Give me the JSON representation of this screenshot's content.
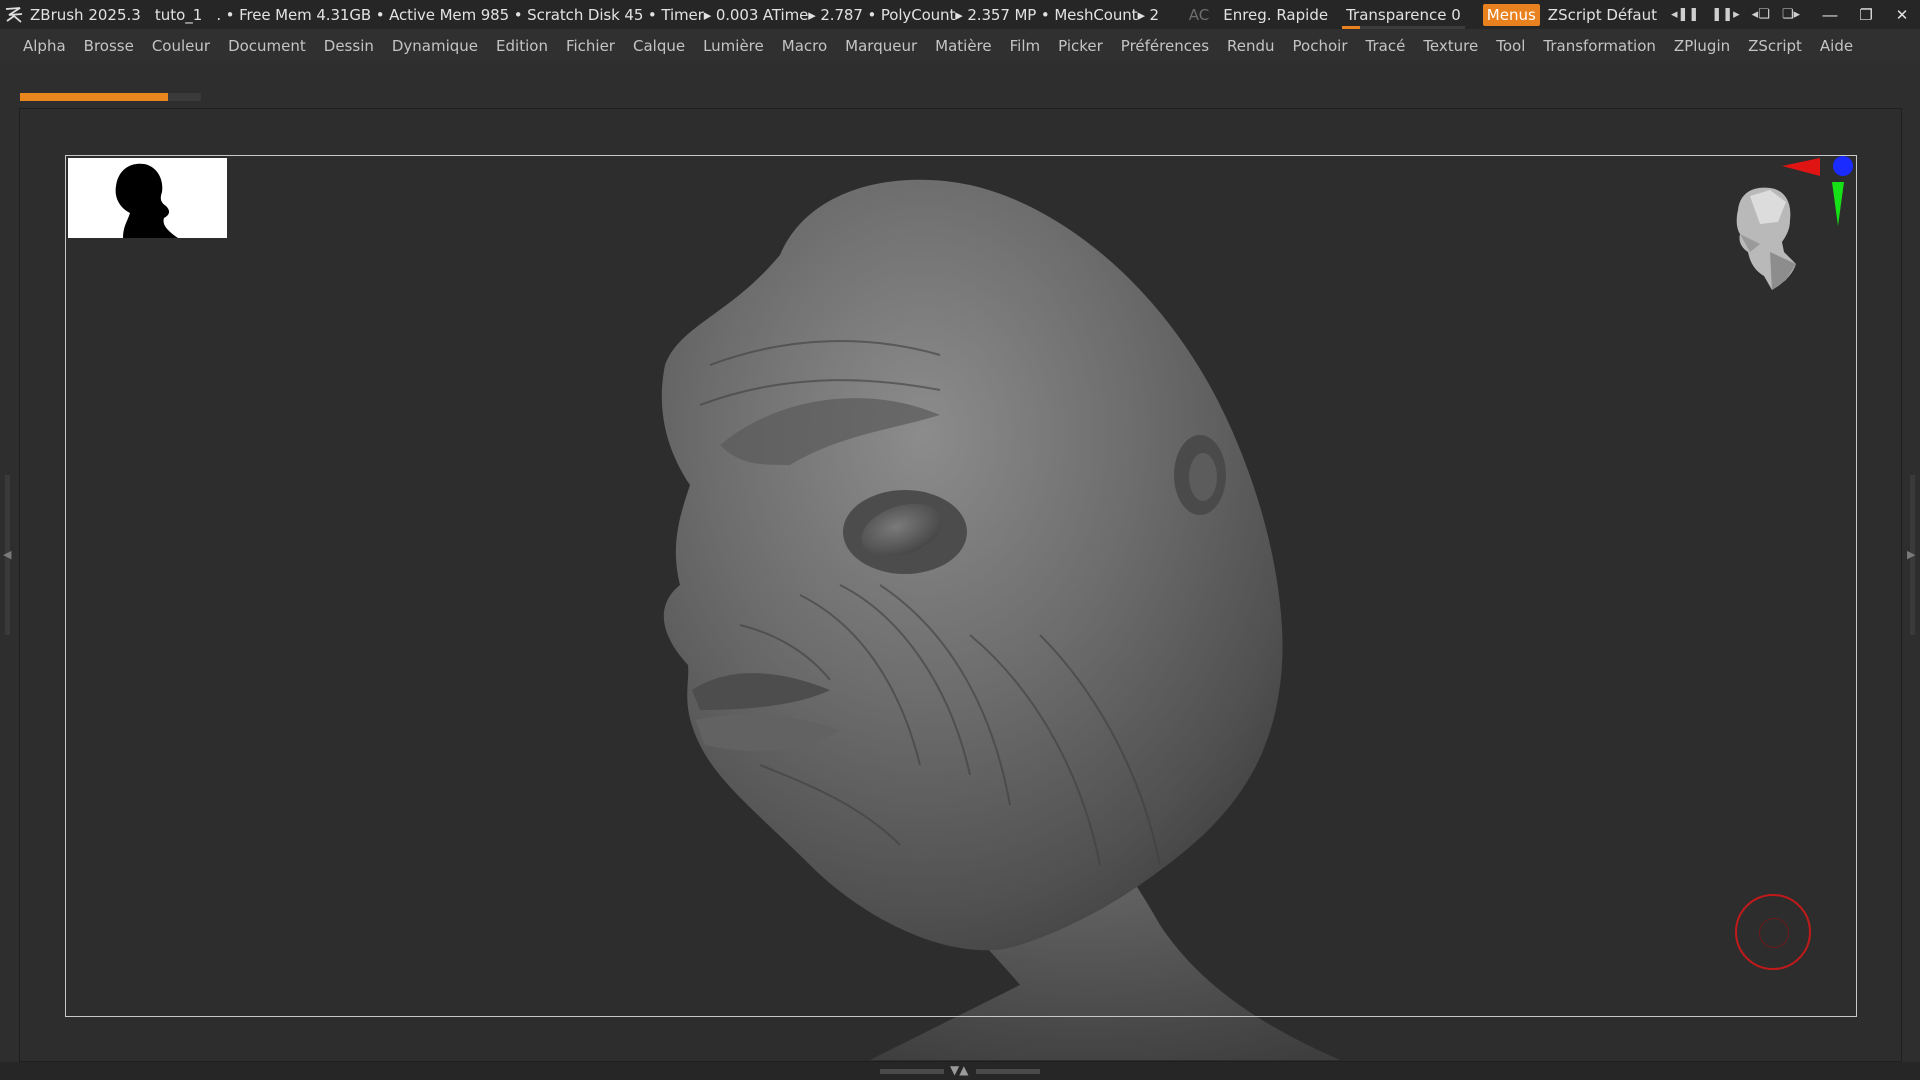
{
  "titlebar": {
    "app_name": "ZBrush 2025.3",
    "document": "tuto_1",
    "stats": ". • Free Mem 4.31GB • Active Mem 985 • Scratch Disk 45 •  Timer▸ 0.003 ATime▸ 2.787 • PolyCount▸ 2.357 MP  • MeshCount▸ 2",
    "ac_label": "AC",
    "quicksave_label": "Enreg. Rapide",
    "transparency_label": "Transparence 0",
    "menus_label": "Menus",
    "zscript_label": "ZScript Défaut",
    "accent_color": "#e8811e"
  },
  "menubar": {
    "items": [
      "Alpha",
      "Brosse",
      "Couleur",
      "Document",
      "Dessin",
      "Dynamique",
      "Edition",
      "Fichier",
      "Calque",
      "Lumière",
      "Macro",
      "Marqueur",
      "Matière",
      "Film",
      "Picker",
      "Préférences",
      "Rendu",
      "Pochoir",
      "Tracé",
      "Texture",
      "Tool",
      "Transformation",
      "ZPlugin",
      "ZScript",
      "Aide"
    ]
  },
  "document_progress": {
    "fraction": 0.82,
    "color": "#ea861e"
  },
  "icons": {
    "app_logo": "zbrush-logo-icon",
    "thumbnail": "head-silhouette-icon",
    "navigation": "head-nav-cube-icon",
    "ring": "record-ring-icon"
  },
  "axis_colors": {
    "x": "#e11414",
    "y": "#16e016",
    "z": "#1a2bff"
  }
}
